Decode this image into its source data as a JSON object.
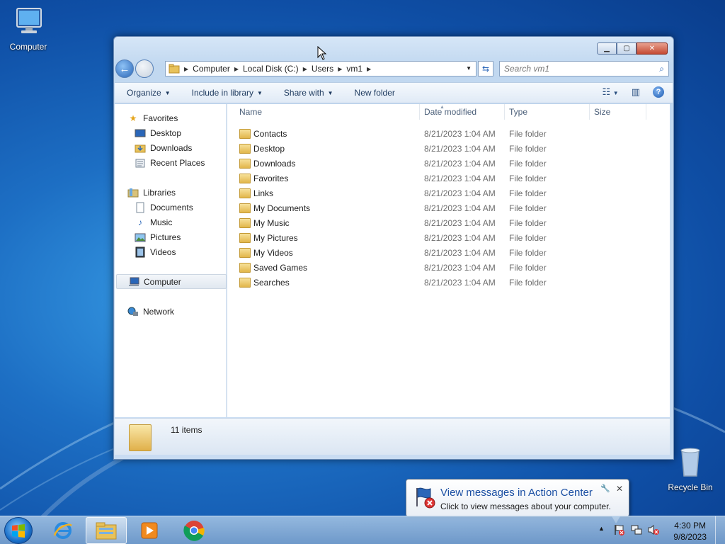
{
  "desktop": {
    "icons": [
      {
        "label": "Computer"
      },
      {
        "label": "Recycle Bin"
      }
    ]
  },
  "window": {
    "address_crumbs": [
      "Computer",
      "Local Disk (C:)",
      "Users",
      "vm1"
    ],
    "search_placeholder": "Search vm1",
    "toolbar": {
      "organize": "Organize",
      "include_in_library": "Include in library",
      "share_with": "Share with",
      "new_folder": "New folder"
    },
    "nav": {
      "favorites": "Favorites",
      "desktop": "Desktop",
      "downloads": "Downloads",
      "recent_places": "Recent Places",
      "libraries": "Libraries",
      "documents": "Documents",
      "music": "Music",
      "pictures": "Pictures",
      "videos": "Videos",
      "computer": "Computer",
      "network": "Network"
    },
    "columns": {
      "name": "Name",
      "date_modified": "Date modified",
      "type": "Type",
      "size": "Size"
    },
    "files": [
      {
        "name": "Contacts",
        "date": "8/21/2023 1:04 AM",
        "type": "File folder"
      },
      {
        "name": "Desktop",
        "date": "8/21/2023 1:04 AM",
        "type": "File folder"
      },
      {
        "name": "Downloads",
        "date": "8/21/2023 1:04 AM",
        "type": "File folder"
      },
      {
        "name": "Favorites",
        "date": "8/21/2023 1:04 AM",
        "type": "File folder"
      },
      {
        "name": "Links",
        "date": "8/21/2023 1:04 AM",
        "type": "File folder"
      },
      {
        "name": "My Documents",
        "date": "8/21/2023 1:04 AM",
        "type": "File folder"
      },
      {
        "name": "My Music",
        "date": "8/21/2023 1:04 AM",
        "type": "File folder"
      },
      {
        "name": "My Pictures",
        "date": "8/21/2023 1:04 AM",
        "type": "File folder"
      },
      {
        "name": "My Videos",
        "date": "8/21/2023 1:04 AM",
        "type": "File folder"
      },
      {
        "name": "Saved Games",
        "date": "8/21/2023 1:04 AM",
        "type": "File folder"
      },
      {
        "name": "Searches",
        "date": "8/21/2023 1:04 AM",
        "type": "File folder"
      }
    ],
    "status": "11 items"
  },
  "balloon": {
    "title": "View messages in Action Center",
    "text": "Click to view messages about your computer."
  },
  "clock": {
    "time": "4:30 PM",
    "date": "9/8/2023"
  },
  "taskbar_apps": [
    "internet-explorer",
    "windows-explorer",
    "media-player",
    "chrome"
  ]
}
